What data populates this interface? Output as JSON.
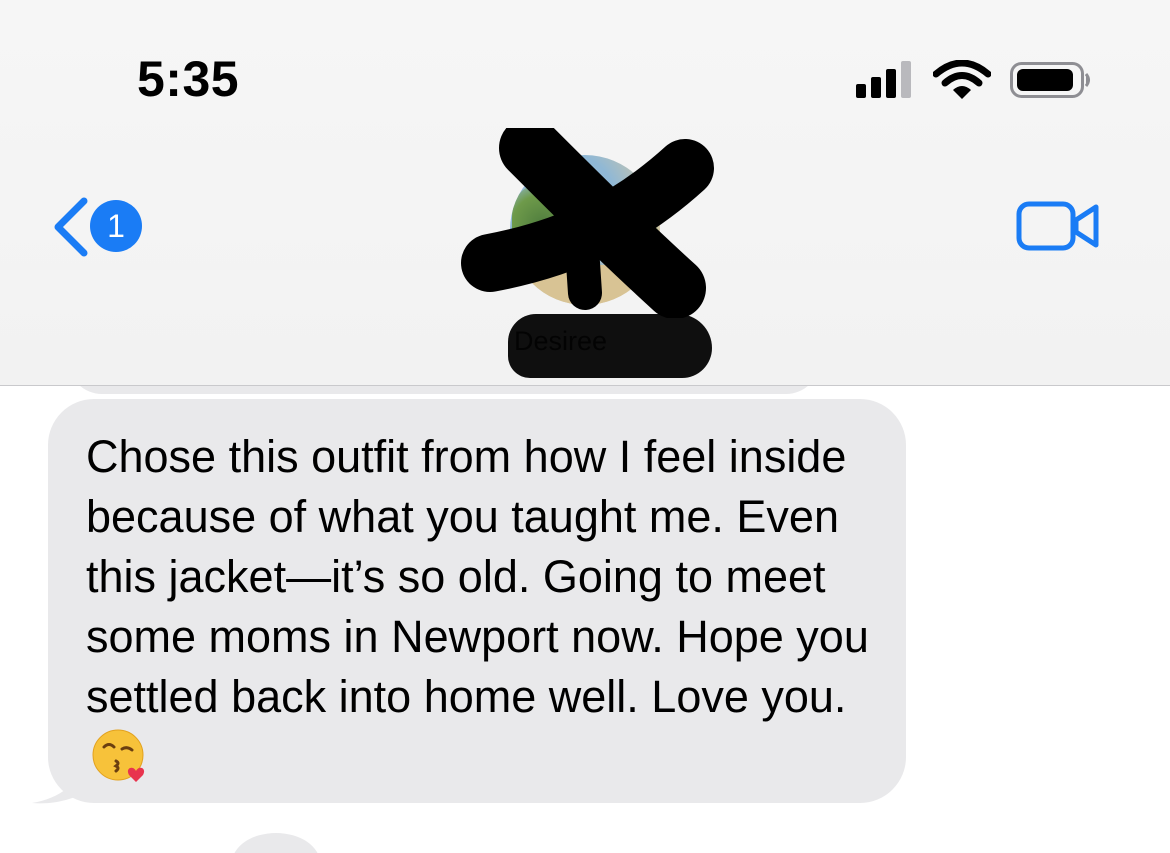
{
  "status_bar": {
    "time": "5:35",
    "signal_icon": "cellular-signal-icon",
    "wifi_icon": "wifi-icon",
    "battery_icon": "battery-icon",
    "signal_bars_active": 3,
    "signal_bars_total": 4
  },
  "nav": {
    "back_icon": "chevron-left-icon",
    "unread_count": "1",
    "video_icon": "video-camera-icon",
    "accent_color": "#1a7cf5",
    "contact_name": "Desiree"
  },
  "messages": [
    {
      "direction": "incoming",
      "text": "Chose this outfit from how I feel inside because of what you taught me. Even this jacket—it’s so old. Going to meet some moms in Newport now. Hope you settled back into home well. Love you.",
      "emoji": "kissing-face-with-heart-emoji"
    }
  ],
  "colors": {
    "incoming_bubble": "#e9e9eb",
    "header_background": "#f6f6f6"
  }
}
